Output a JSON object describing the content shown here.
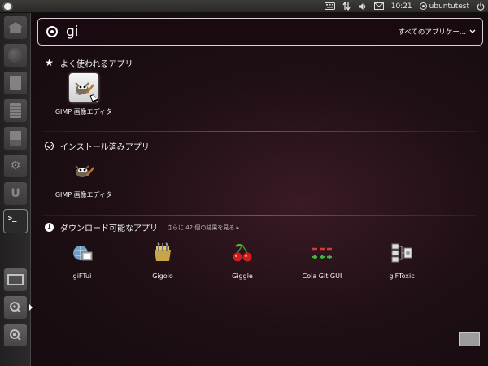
{
  "top_panel": {
    "time": "10:21",
    "user": "ubuntutest"
  },
  "search": {
    "query": "gi",
    "filter_label": "すべてのアプリケー..."
  },
  "sections": {
    "frequent": {
      "title": "よく使われるアプリ",
      "apps": [
        {
          "name": "GIMP 画像エディタ",
          "icon": "gimp-icon"
        }
      ]
    },
    "installed": {
      "title": "インストール済みアプリ",
      "apps": [
        {
          "name": "GIMP 画像エディタ",
          "icon": "gimp-icon"
        }
      ]
    },
    "downloadable": {
      "title": "ダウンロード可能なアプリ",
      "more_results": "さらに 42 個の結果を見る",
      "apps": [
        {
          "name": "giFTui",
          "icon": "giftui-icon"
        },
        {
          "name": "Gigolo",
          "icon": "gigolo-icon"
        },
        {
          "name": "Giggle",
          "icon": "giggle-icon"
        },
        {
          "name": "Cola Git GUI",
          "icon": "cola-git-icon"
        },
        {
          "name": "giFToxic",
          "icon": "giftoxic-icon"
        }
      ]
    }
  },
  "launcher": {
    "items": [
      "home-folder-icon",
      "firefox-icon",
      "writer-icon",
      "calc-icon",
      "impress-icon",
      "software-center-icon",
      "ubuntu-one-icon",
      "terminal-icon",
      "workspace-switcher-icon",
      "applications-lens-icon",
      "files-lens-icon"
    ]
  }
}
